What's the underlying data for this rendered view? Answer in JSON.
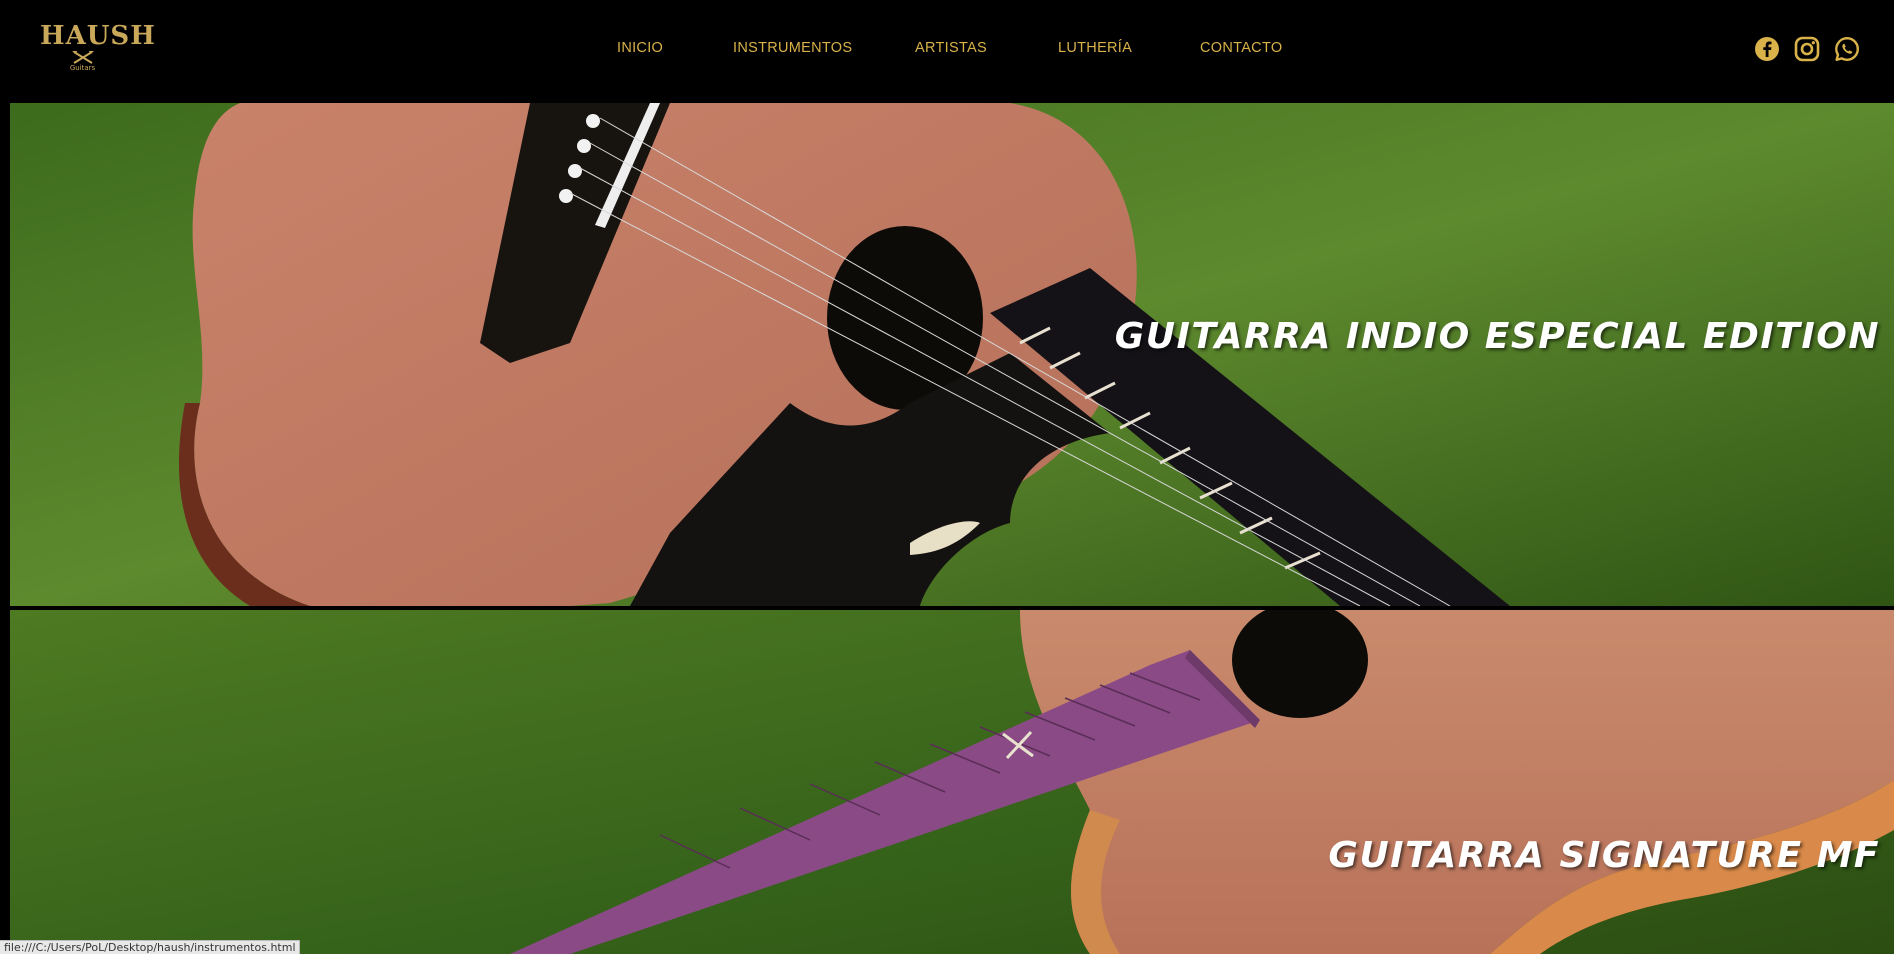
{
  "header": {
    "logo": {
      "word": "HAUSH",
      "sub": "Guitars"
    },
    "nav": [
      {
        "label": "INICIO"
      },
      {
        "label": "INSTRUMENTOS"
      },
      {
        "label": "ARTISTAS"
      },
      {
        "label": "LUTHERÍA"
      },
      {
        "label": "CONTACTO"
      }
    ],
    "social": [
      {
        "icon": "facebook-icon"
      },
      {
        "icon": "instagram-icon"
      },
      {
        "icon": "whatsapp-icon"
      }
    ]
  },
  "banners": [
    {
      "title": "GUITARRA INDIO ESPECIAL EDITION"
    },
    {
      "title": "GUITARRA SIGNATURE MF"
    }
  ],
  "status_bar": {
    "url": "file:///C:/Users/PoL/Desktop/haush/instrumentos.html"
  },
  "colors": {
    "accent": "#d9b24a",
    "logo": "#c9a85a",
    "background": "#000000",
    "grass": "#4b7424",
    "wood": "#c98a6c",
    "fretboard_purple": "#8a4a86"
  }
}
